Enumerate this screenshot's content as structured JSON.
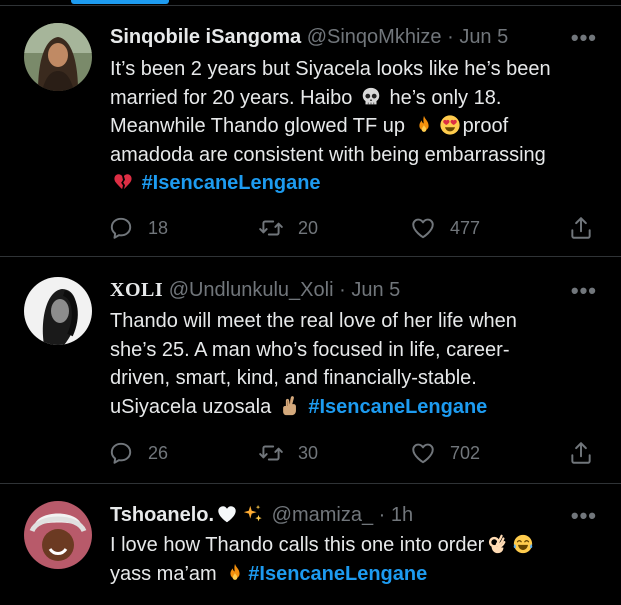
{
  "tweets": [
    {
      "display_name": "Sinqobile iSangoma",
      "handle": "@SinqoMkhize",
      "dot": "·",
      "time": "Jun 5",
      "body_lines": [
        "It’s been 2 years but Siyacela looks like he’s been",
        "married for 20 years. Haibo",
        " he’s only 18.",
        "Meanwhile Thando glowed TF up",
        "proof",
        "amadoda are consistent with being embarrassing"
      ],
      "hashtag": "#IsencaneLengane",
      "emojis": [
        "skull-emoji",
        "fire-emoji",
        "heart-eyes-emoji",
        "broken-heart-emoji"
      ],
      "replies": "18",
      "retweets": "20",
      "likes": "477"
    },
    {
      "display_name": "XOLI",
      "handle": "@Undlunkulu_Xoli",
      "dot": "·",
      "time": "Jun 5",
      "body_lines": [
        "Thando will meet the real love of her life when",
        "she’s 25. A man who’s focused in life, career-",
        "driven, smart, kind, and financially-stable.",
        "uSiyacela uzosala"
      ],
      "hashtag": "#IsencaneLengane",
      "emojis": [
        "crossed-fingers-emoji"
      ],
      "replies": "26",
      "retweets": "30",
      "likes": "702"
    },
    {
      "display_name": "Tshoanelo.",
      "handle": "@mamiza_",
      "dot": "·",
      "time": "1h",
      "body_lines": [
        "I love how Thando calls this one into order",
        "yass ma’am"
      ],
      "hashtag": "#IsencaneLengane",
      "emojis": [
        "white-heart-emoji",
        "sparkles-emoji",
        "ok-hand-emoji",
        "tears-of-joy-emoji",
        "fire-emoji"
      ]
    }
  ],
  "more_label": "•••",
  "colors": {
    "accent": "#1d9bf0",
    "muted": "#71767b",
    "text": "#e7e9ea",
    "divider": "#2f3336"
  },
  "icons": [
    "reply-icon",
    "retweet-icon",
    "like-icon",
    "share-icon",
    "more-options-icon"
  ]
}
